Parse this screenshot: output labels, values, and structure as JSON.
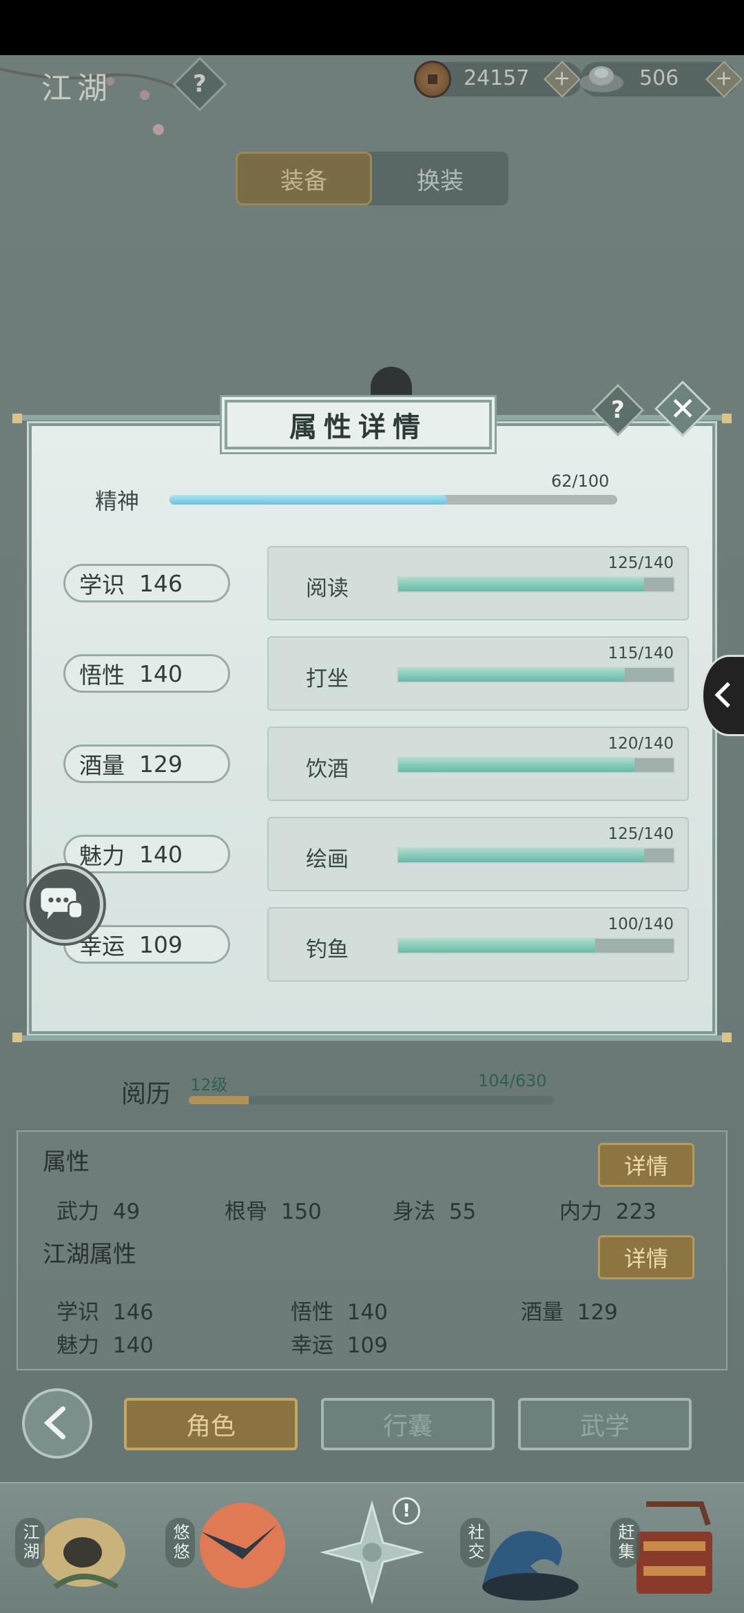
{
  "topbar": {
    "title": "江湖",
    "help_label": "?",
    "copper": "24157",
    "silver": "506",
    "plus_label": "+"
  },
  "equip_tabs": [
    "装备",
    "换装"
  ],
  "modal": {
    "title": "属性详情",
    "help_label": "?",
    "close_label": "✕",
    "spirit": {
      "label": "精神",
      "value": "62/100",
      "current": 62,
      "max": 100
    },
    "stats": [
      {
        "label": "学识",
        "value": "146",
        "activity": "阅读",
        "progress": "125/140",
        "current": 125,
        "max": 140
      },
      {
        "label": "悟性",
        "value": "140",
        "activity": "打坐",
        "progress": "115/140",
        "current": 115,
        "max": 140
      },
      {
        "label": "酒量",
        "value": "129",
        "activity": "饮酒",
        "progress": "120/140",
        "current": 120,
        "max": 140
      },
      {
        "label": "魅力",
        "value": "140",
        "activity": "绘画",
        "progress": "125/140",
        "current": 125,
        "max": 140
      },
      {
        "label": "幸运",
        "value": "109",
        "activity": "钓鱼",
        "progress": "100/140",
        "current": 100,
        "max": 140
      }
    ]
  },
  "experience": {
    "label": "阅历",
    "level": "12级",
    "value": "104/630",
    "current": 104,
    "max": 630
  },
  "attributes": {
    "title": "属性",
    "detail_label": "详情",
    "items": [
      {
        "label": "武力",
        "value": "49"
      },
      {
        "label": "根骨",
        "value": "150"
      },
      {
        "label": "身法",
        "value": "55"
      },
      {
        "label": "内力",
        "value": "223"
      }
    ]
  },
  "jianghu_attributes": {
    "title": "江湖属性",
    "detail_label": "详情",
    "items": [
      {
        "label": "学识",
        "value": "146"
      },
      {
        "label": "悟性",
        "value": "140"
      },
      {
        "label": "酒量",
        "value": "129"
      },
      {
        "label": "魅力",
        "value": "140"
      },
      {
        "label": "幸运",
        "value": "109"
      }
    ]
  },
  "bottom_tabs": [
    "角色",
    "行囊",
    "武学"
  ],
  "nav": [
    {
      "label": "江湖",
      "icon": "hat-icon"
    },
    {
      "label": "悠悠",
      "icon": "swallow-icon"
    },
    {
      "label": "",
      "icon": "compass-star-icon",
      "badge": "!"
    },
    {
      "label": "社交",
      "icon": "wave-icon"
    },
    {
      "label": "赶集",
      "icon": "basket-icon"
    }
  ],
  "colors": {
    "background": "#7b8a86",
    "gold": "#8d7542",
    "teal_fill": "#68b9a7",
    "spirit_fill": "#6cc2dc"
  }
}
